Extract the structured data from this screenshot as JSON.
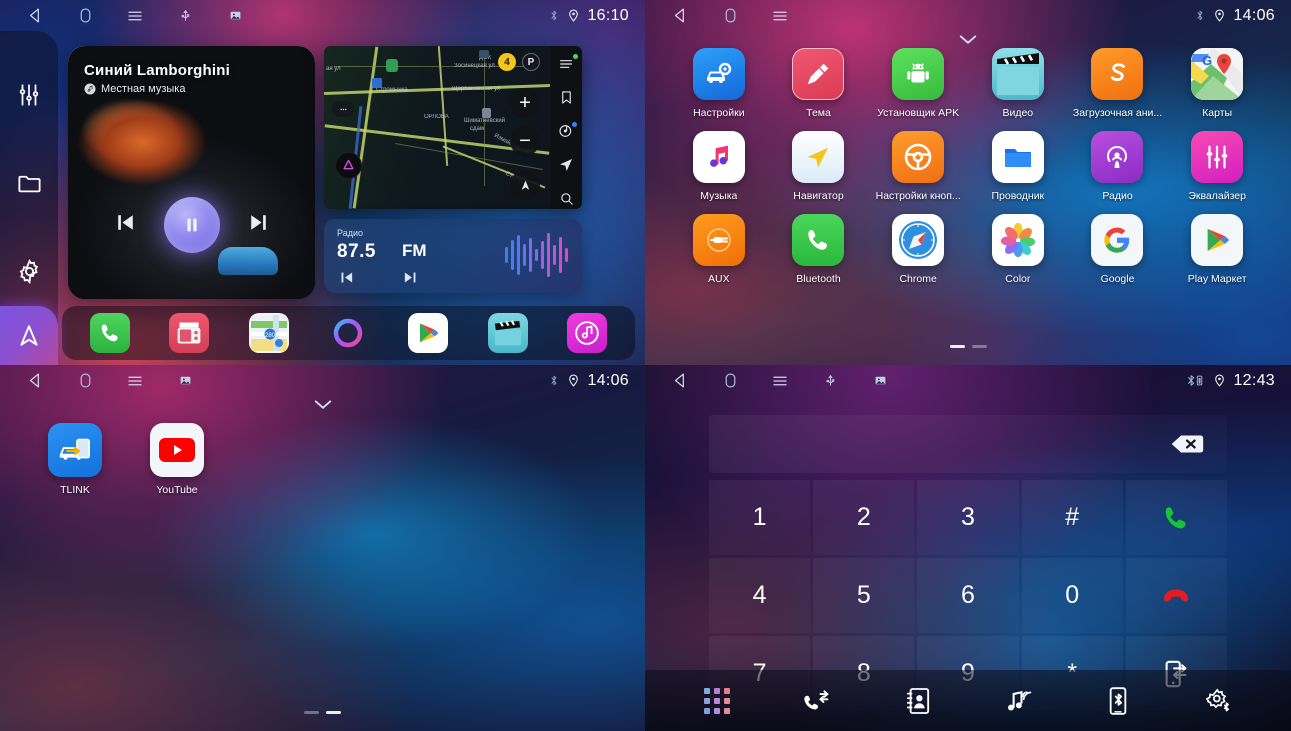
{
  "panels": {
    "home": {
      "statusbar": {
        "time": "16:10",
        "nav_icons": [
          "back-icon",
          "home-icon",
          "menu-icon",
          "usb-icon",
          "screenshot-icon"
        ],
        "status_icons": [
          "bluetooth-icon",
          "location-icon"
        ]
      },
      "sidebar": [
        {
          "name": "equalizer-icon",
          "label": "Equalizer"
        },
        {
          "name": "folder-icon",
          "label": "Files"
        },
        {
          "name": "gear-icon",
          "label": "Settings"
        },
        {
          "name": "navigation-icon",
          "label": "Navigation"
        }
      ],
      "music": {
        "title": "Синий Lamborghini",
        "subtitle": "Местная музыка",
        "source_icon": "music-note-icon",
        "prev_icon": "previous-track-icon",
        "play_icon": "pause-icon",
        "next_icon": "next-track-icon",
        "state": "playing"
      },
      "map": {
        "labels": [
          "ая ул",
          "Зосинецкая ул",
          "Щербаковская",
          "Стромынка",
          "ДОК",
          "ОРЛОВА",
          "Шиматневский сдам",
          "Измайловское",
          "Стромынка"
        ],
        "badge_count": "4",
        "parking_badge": "P",
        "zoom_in": "+",
        "zoom_out": "−",
        "right_icons": [
          "menu-icon",
          "bookmark-icon",
          "music-disc-icon",
          "locate-icon",
          "search-icon"
        ],
        "compass_icon": "compass-icon",
        "yandex_icon": "yandex-logo-icon"
      },
      "radio": {
        "label": "Радио",
        "frequency": "87.5",
        "band": "FM",
        "prev_icon": "previous-station-icon",
        "next_icon": "next-station-icon",
        "visualizer_icon": "waveform-icon"
      },
      "dock": [
        {
          "name": "phone-icon",
          "label": "Phone"
        },
        {
          "name": "radio-icon",
          "label": "Radio"
        },
        {
          "name": "maps-icon",
          "label": "Maps"
        },
        {
          "name": "voice-assistant-icon",
          "label": "Assistant"
        },
        {
          "name": "play-store-icon",
          "label": "Play Store"
        },
        {
          "name": "video-icon",
          "label": "Video"
        },
        {
          "name": "music-icon",
          "label": "Music"
        }
      ]
    },
    "apps": {
      "statusbar": {
        "time": "14:06",
        "nav_icons": [
          "back-icon",
          "home-icon",
          "menu-icon"
        ],
        "status_icons": [
          "bluetooth-icon",
          "location-icon"
        ]
      },
      "collapse_icon": "chevron-down-icon",
      "items": [
        {
          "label": "Настройки",
          "icon": "car-settings-icon",
          "bg": "#1a8cf0"
        },
        {
          "label": "Тема",
          "icon": "theme-brush-icon",
          "bg": "#e7465f"
        },
        {
          "label": "Установщик APK",
          "icon": "android-icon",
          "bg": "#4cd14c"
        },
        {
          "label": "Видео",
          "icon": "clapperboard-icon",
          "bg": "#6fd7e0"
        },
        {
          "label": "Загрузочная ани...",
          "icon": "boot-animation-icon",
          "bg": "#f58220"
        },
        {
          "label": "Карты",
          "icon": "google-maps-icon",
          "bg": "#ffffff"
        },
        {
          "label": "Музыка",
          "icon": "music-note-icon",
          "bg": "#ffffff"
        },
        {
          "label": "Навигатор",
          "icon": "navigator-arrow-icon",
          "bg": "#eef6fb"
        },
        {
          "label": "Настройки кноп...",
          "icon": "steering-wheel-icon",
          "bg": "#f58220"
        },
        {
          "label": "Проводник",
          "icon": "file-folder-icon",
          "bg": "#ffffff"
        },
        {
          "label": "Радио",
          "icon": "podcast-radio-icon",
          "bg": "#a63cd0"
        },
        {
          "label": "Эквалайзер",
          "icon": "equalizer-sliders-icon",
          "bg": "#ec2fa0"
        },
        {
          "label": "AUX",
          "icon": "aux-plug-icon",
          "bg": "#f5800a"
        },
        {
          "label": "Bluetooth",
          "icon": "phone-handset-icon",
          "bg": "#3ccf4e"
        },
        {
          "label": "Chrome",
          "icon": "safari-compass-icon",
          "bg": "#ffffff"
        },
        {
          "label": "Color",
          "icon": "photos-flower-icon",
          "bg": "#ffffff"
        },
        {
          "label": "Google",
          "icon": "google-g-icon",
          "bg": "#f3f6fa"
        },
        {
          "label": "Play Маркет",
          "icon": "play-store-icon",
          "bg": "#f3f6fa"
        }
      ],
      "page_dots": {
        "count": 2,
        "active": 0
      }
    },
    "home2": {
      "statusbar": {
        "time": "14:06",
        "nav_icons": [
          "back-icon",
          "home-icon",
          "menu-icon",
          "screenshot-icon"
        ],
        "status_icons": [
          "bluetooth-icon",
          "location-icon"
        ]
      },
      "collapse_icon": "chevron-down-icon",
      "items": [
        {
          "label": "TLINK",
          "icon": "tlink-carplay-icon",
          "bg": "#1f86e8"
        },
        {
          "label": "YouTube",
          "icon": "youtube-icon",
          "bg": "#f2f6fa"
        }
      ],
      "page_dots": {
        "count": 2,
        "active": 1
      }
    },
    "dialer": {
      "statusbar": {
        "time": "12:43",
        "nav_icons": [
          "back-icon",
          "home-icon",
          "menu-icon",
          "usb-icon",
          "screenshot-icon"
        ],
        "status_icons": [
          "bluetooth-battery-icon",
          "location-icon"
        ]
      },
      "display": {
        "number": "",
        "placeholder": "",
        "backspace_icon": "backspace-icon"
      },
      "keys": [
        {
          "label": "1",
          "name": "key-1"
        },
        {
          "label": "2",
          "name": "key-2"
        },
        {
          "label": "3",
          "name": "key-3"
        },
        {
          "label": "#",
          "name": "key-hash"
        },
        {
          "label": "",
          "name": "call-button",
          "icon": "call-green-icon"
        },
        {
          "label": "4",
          "name": "key-4"
        },
        {
          "label": "5",
          "name": "key-5"
        },
        {
          "label": "6",
          "name": "key-6"
        },
        {
          "label": "0",
          "name": "key-0"
        },
        {
          "label": "",
          "name": "hangup-button",
          "icon": "hangup-red-icon"
        },
        {
          "label": "7",
          "name": "key-7"
        },
        {
          "label": "8",
          "name": "key-8"
        },
        {
          "label": "9",
          "name": "key-9"
        },
        {
          "label": "*",
          "name": "key-star"
        },
        {
          "label": "",
          "name": "transfer-audio-button",
          "icon": "transfer-to-phone-icon"
        }
      ],
      "toolbar": [
        {
          "name": "keypad-tab",
          "icon": "keypad-dots-icon",
          "active": true
        },
        {
          "name": "call-log-tab",
          "icon": "call-log-icon",
          "active": false
        },
        {
          "name": "contacts-tab",
          "icon": "contacts-book-icon",
          "active": false
        },
        {
          "name": "bt-music-tab",
          "icon": "bluetooth-music-icon",
          "active": false
        },
        {
          "name": "device-tab",
          "icon": "bluetooth-phone-icon",
          "active": false
        },
        {
          "name": "bt-settings-tab",
          "icon": "bluetooth-settings-icon",
          "active": false
        }
      ]
    }
  },
  "colors": {
    "accent_purple": "#8f88ee",
    "call_green": "#22c55e",
    "hangup_red": "#e11d2e",
    "radio_wave_start": "#3b82f6",
    "radio_wave_end": "#d946ef"
  }
}
